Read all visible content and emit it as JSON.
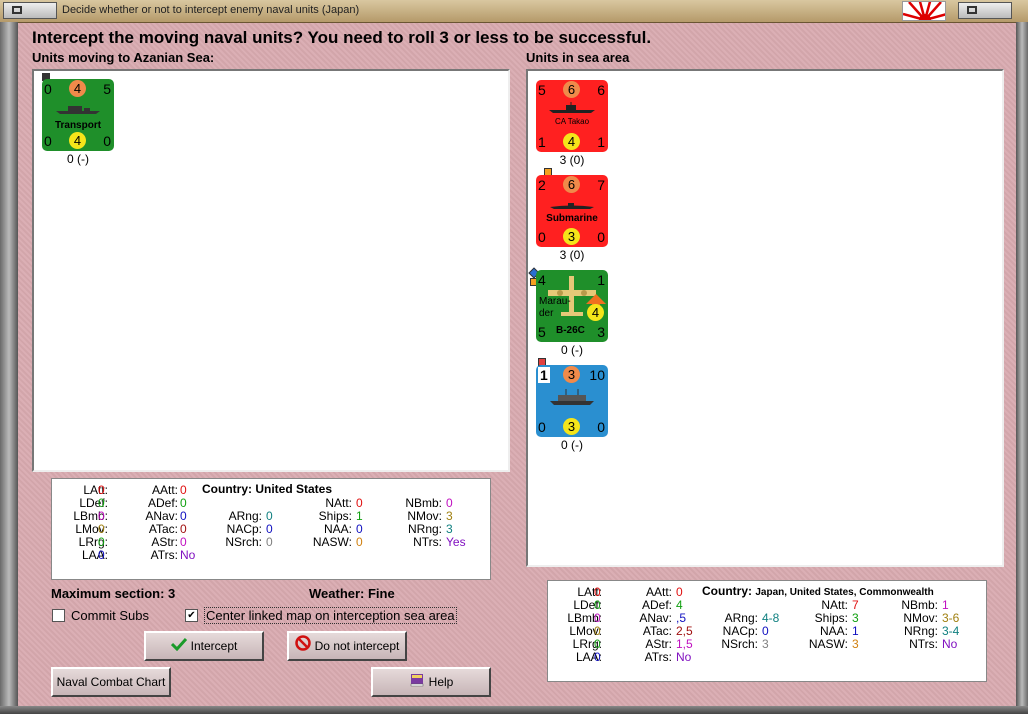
{
  "window": {
    "title": "Decide whether or not to intercept enemy naval units (Japan)"
  },
  "header": {
    "text": "Intercept the moving naval units?  You need to roll 3 or less to be successful."
  },
  "left_panel": {
    "label": "Units moving to Azanian Sea:",
    "units": [
      {
        "name": "Transport",
        "tl": "0",
        "tc": "4",
        "tr": "5",
        "bl": "0",
        "bc": "4",
        "br": "0",
        "caption": "0 (-)",
        "color": "#1f8f2a"
      }
    ]
  },
  "right_panel": {
    "label": "Units in sea area",
    "units": [
      {
        "name": "CA Takao",
        "tl": "5",
        "tc": "6",
        "tr": "6",
        "bl": "1",
        "bc": "4",
        "br": "1",
        "caption": "3 (0)",
        "color": "#ff2020"
      },
      {
        "name": "Submarine",
        "tl": "2",
        "tc": "6",
        "tr": "7",
        "bl": "0",
        "bc": "3",
        "br": "0",
        "caption": "3 (0)",
        "color": "#ff2020"
      },
      {
        "name": "B-26C",
        "name2": "Marau-\nder",
        "tl": "4",
        "tr": "1",
        "bl": "5",
        "br": "3",
        "bc": "4",
        "caption": "0 (-)",
        "color": "#1f8f2a"
      },
      {
        "name": "",
        "tl": "1",
        "tc": "3",
        "tr": "10",
        "bl": "0",
        "bc": "3",
        "br": "0",
        "caption": "0 (-)",
        "color": "#2a8fd0"
      }
    ]
  },
  "left_stats": {
    "country_label": "Country:",
    "country": "United States",
    "col1": [
      {
        "k": "LAtt:",
        "v": "0",
        "c": "#e01010"
      },
      {
        "k": "LDef:",
        "v": "0",
        "c": "#10a010"
      },
      {
        "k": "LBmb:",
        "v": "0",
        "c": "#c010c0"
      },
      {
        "k": "LMov:",
        "v": "0",
        "c": "#a08010"
      },
      {
        "k": "LRrg:",
        "v": "0",
        "c": "#10a010"
      },
      {
        "k": "LAA:",
        "v": "0",
        "c": "#1010c0"
      }
    ],
    "col2": [
      {
        "k": "AAtt:",
        "v": "0",
        "c": "#e01010"
      },
      {
        "k": "ADef:",
        "v": "0",
        "c": "#10a010"
      },
      {
        "k": "ANav:",
        "v": "0",
        "c": "#1010c0"
      },
      {
        "k": "ATac:",
        "v": "0",
        "c": "#a01010"
      },
      {
        "k": "AStr:",
        "v": "0",
        "c": "#c010c0"
      },
      {
        "k": "ATrs:",
        "v": "No",
        "c": "#8010c0"
      }
    ],
    "col3": [
      {
        "k": "ARng:",
        "v": "0",
        "c": "#108080"
      },
      {
        "k": "NACp:",
        "v": "0",
        "c": "#1010c0"
      },
      {
        "k": "NSrch:",
        "v": "0",
        "c": "#808080"
      }
    ],
    "col4": [
      {
        "k": "NAtt:",
        "v": "0",
        "c": "#e01010"
      },
      {
        "k": "Ships:",
        "v": "1",
        "c": "#10a010"
      },
      {
        "k": "NAA:",
        "v": "0",
        "c": "#1010c0"
      },
      {
        "k": "NASW:",
        "v": "0",
        "c": "#d08010"
      }
    ],
    "col5": [
      {
        "k": "NBmb:",
        "v": "0",
        "c": "#c010c0"
      },
      {
        "k": "NMov:",
        "v": "3",
        "c": "#a08010"
      },
      {
        "k": "NRng:",
        "v": "3",
        "c": "#108080"
      },
      {
        "k": "NTrs:",
        "v": "Yes",
        "c": "#8010c0"
      }
    ]
  },
  "right_stats": {
    "country_label": "Country:",
    "country": "Japan, United States, Commonwealth",
    "col1": [
      {
        "k": "LAtt:",
        "v": "0",
        "c": "#e01010"
      },
      {
        "k": "LDef:",
        "v": "0",
        "c": "#10a010"
      },
      {
        "k": "LBmb:",
        "v": "0",
        "c": "#c010c0"
      },
      {
        "k": "LMov:",
        "v": "0",
        "c": "#a08010"
      },
      {
        "k": "LRrg:",
        "v": "0",
        "c": "#10a010"
      },
      {
        "k": "LAA:",
        "v": "0",
        "c": "#1010c0"
      }
    ],
    "col2": [
      {
        "k": "AAtt:",
        "v": "0",
        "c": "#e01010"
      },
      {
        "k": "ADef:",
        "v": "4",
        "c": "#10a010"
      },
      {
        "k": "ANav:",
        "v": ",5",
        "c": "#1010c0"
      },
      {
        "k": "ATac:",
        "v": "2,5",
        "c": "#a01010"
      },
      {
        "k": "AStr:",
        "v": "1,5",
        "c": "#c010c0"
      },
      {
        "k": "ATrs:",
        "v": "No",
        "c": "#8010c0"
      }
    ],
    "col3": [
      {
        "k": "ARng:",
        "v": "4-8",
        "c": "#108080"
      },
      {
        "k": "NACp:",
        "v": "0",
        "c": "#1010c0"
      },
      {
        "k": "NSrch:",
        "v": "3",
        "c": "#808080"
      }
    ],
    "col4": [
      {
        "k": "NAtt:",
        "v": "7",
        "c": "#e01010"
      },
      {
        "k": "Ships:",
        "v": "3",
        "c": "#10a010"
      },
      {
        "k": "NAA:",
        "v": "1",
        "c": "#1010c0"
      },
      {
        "k": "NASW:",
        "v": "3",
        "c": "#d08010"
      }
    ],
    "col5": [
      {
        "k": "NBmb:",
        "v": "1",
        "c": "#c010c0"
      },
      {
        "k": "NMov:",
        "v": "3-6",
        "c": "#a08010"
      },
      {
        "k": "NRng:",
        "v": "3-4",
        "c": "#108080"
      },
      {
        "k": "NTrs:",
        "v": "No",
        "c": "#8010c0"
      }
    ]
  },
  "info": {
    "max_section_label": "Maximum section: 3",
    "weather_label": "Weather:  Fine"
  },
  "options": {
    "commit_subs": {
      "label": "Commit Subs",
      "checked": false
    },
    "center_map": {
      "label": "Center linked map on interception sea area",
      "checked": true
    }
  },
  "buttons": {
    "intercept": "Intercept",
    "do_not_intercept": "Do not intercept",
    "naval_combat_chart": "Naval Combat Chart",
    "help": "Help"
  }
}
